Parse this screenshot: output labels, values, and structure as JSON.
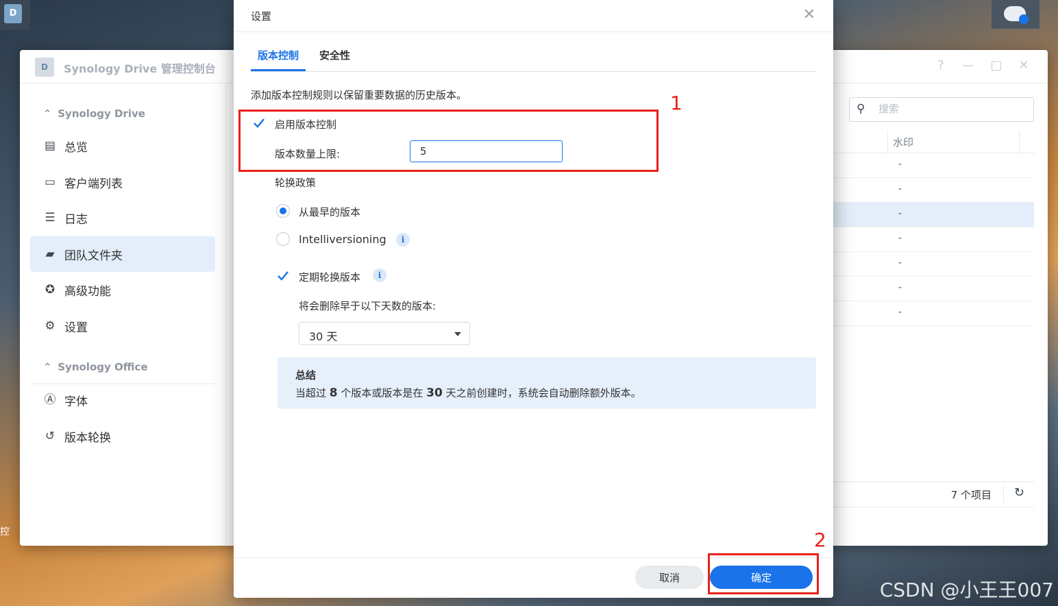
{
  "desktop": {
    "app_icon_letter": "D",
    "side_label": "控",
    "watermark": "CSDN @小王王007"
  },
  "main_window": {
    "title": "Synology Drive 管理控制台",
    "icon_letter": "D",
    "controls": {
      "help": "?",
      "minimize": "—",
      "maximize": "□",
      "close": "✕"
    },
    "sidebar": {
      "group1": "Synology Drive",
      "items1": [
        {
          "label": "总览",
          "icon": "overview-icon"
        },
        {
          "label": "客户端列表",
          "icon": "client-list-icon"
        },
        {
          "label": "日志",
          "icon": "log-icon"
        },
        {
          "label": "团队文件夹",
          "icon": "team-folder-icon",
          "active": true
        },
        {
          "label": "高级功能",
          "icon": "advanced-icon"
        },
        {
          "label": "设置",
          "icon": "gear-icon"
        }
      ],
      "group2": "Synology Office",
      "items2": [
        {
          "label": "字体",
          "icon": "font-icon"
        },
        {
          "label": "版本轮换",
          "icon": "history-icon"
        }
      ]
    },
    "search": {
      "placeholder": "搜索"
    },
    "table": {
      "column": "水印",
      "rows": [
        "-",
        "-",
        "-",
        "-",
        "-",
        "-",
        "-"
      ],
      "selected_row": 2,
      "footer_count": "7 个项目"
    }
  },
  "dialog": {
    "title": "设置",
    "close": "✕",
    "tabs": [
      {
        "label": "版本控制",
        "active": true
      },
      {
        "label": "安全性",
        "active": false
      }
    ],
    "description": "添加版本控制规则以保留重要数据的历史版本。",
    "enable_versioning": {
      "label": "启用版本控制",
      "checked": true
    },
    "max_versions": {
      "label": "版本数量上限:",
      "value": "5"
    },
    "rotation_policy": {
      "label": "轮换政策",
      "options": [
        {
          "label": "从最早的版本",
          "selected": true
        },
        {
          "label": "Intelliversioning",
          "selected": false
        }
      ],
      "info_glyph": "i"
    },
    "periodic_rotation": {
      "label": "定期轮换版本",
      "checked": true
    },
    "delete_older": {
      "label": "将会删除早于以下天数的版本:",
      "value": "30 天"
    },
    "summary": {
      "heading": "总结",
      "text_a": "当超过 ",
      "num_versions": "8",
      "text_b": " 个版本或版本是在 ",
      "num_days": "30",
      "text_c": " 天之前创建时，系统会自动删除额外版本。"
    },
    "buttons": {
      "cancel": "取消",
      "ok": "确定"
    }
  },
  "annotations": {
    "box1_label": "1",
    "box2_label": "2",
    "color": "#e8201b"
  },
  "colors": {
    "accent": "#1a73e8",
    "selected_bg": "#e3eefa",
    "summary_bg": "#e6f0fb"
  }
}
